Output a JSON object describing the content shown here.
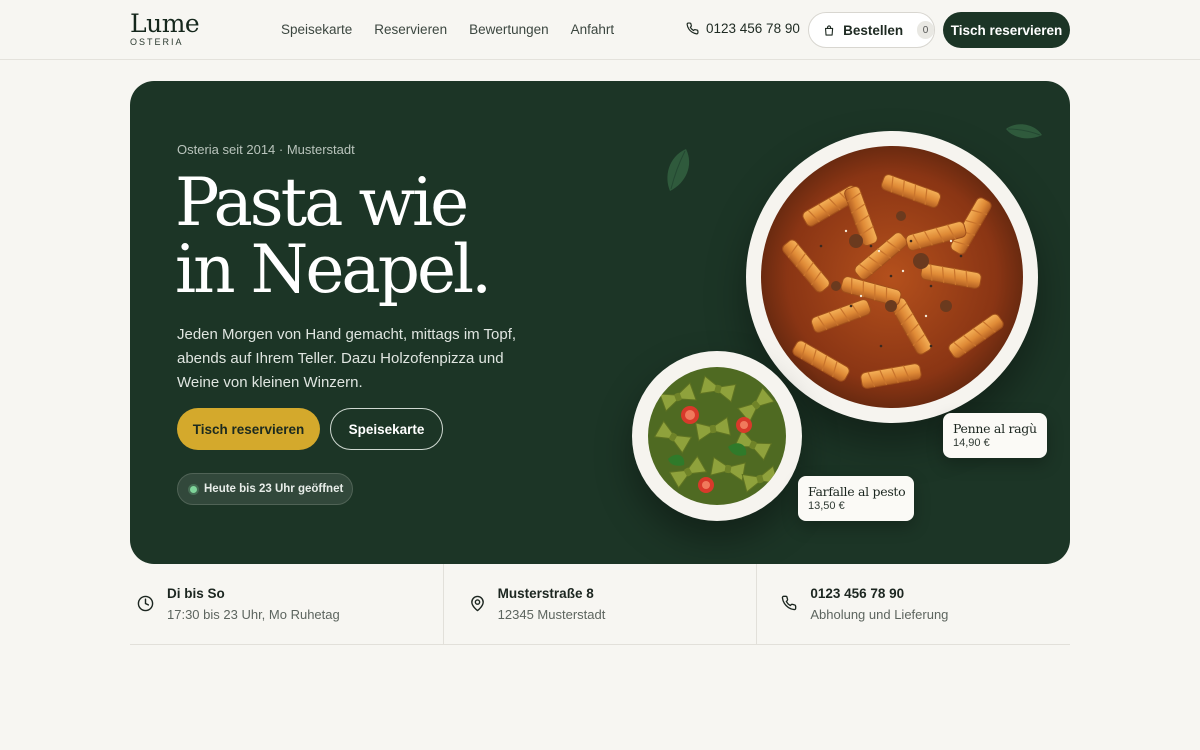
{
  "brand": {
    "name": "Lume",
    "tagline": "OSTERIA"
  },
  "nav": {
    "items": [
      "Speisekarte",
      "Reservieren",
      "Bewertungen",
      "Anfahrt"
    ]
  },
  "header": {
    "phone": "0123 456 78 90",
    "order_label": "Bestellen",
    "cart_count": "0",
    "reserve_label": "Tisch reservieren"
  },
  "hero": {
    "eyebrow": "Osteria seit 2014 · Musterstadt",
    "headline_line1": "Pasta wie",
    "headline_line2": "in Neapel.",
    "lead": "Jeden Morgen von Hand gemacht, mittags im Topf, abends auf Ihrem Teller. Dazu Holzofenpizza und Weine von kleinen Winzern.",
    "primary_cta": "Tisch reservieren",
    "secondary_cta": "Speisekarte",
    "status": "Heute bis 23 Uhr geöffnet",
    "dishes": [
      {
        "name": "Penne al ragù",
        "price": "14,90 €"
      },
      {
        "name": "Farfalle al pesto",
        "price": "13,50 €"
      }
    ]
  },
  "info": [
    {
      "icon": "clock-icon",
      "title": "Di bis So",
      "subtitle": "17:30 bis 23 Uhr, Mo Ruhetag"
    },
    {
      "icon": "map-pin-icon",
      "title": "Musterstraße 8",
      "subtitle": "12345 Musterstadt"
    },
    {
      "icon": "phone-icon",
      "title": "0123 456 78 90",
      "subtitle": "Abholung und Lieferung"
    }
  ],
  "colors": {
    "primary_dark": "#1c3526",
    "accent_gold": "#d4a92c",
    "background": "#f7f6f2",
    "open_dot": "#7fd49a"
  }
}
